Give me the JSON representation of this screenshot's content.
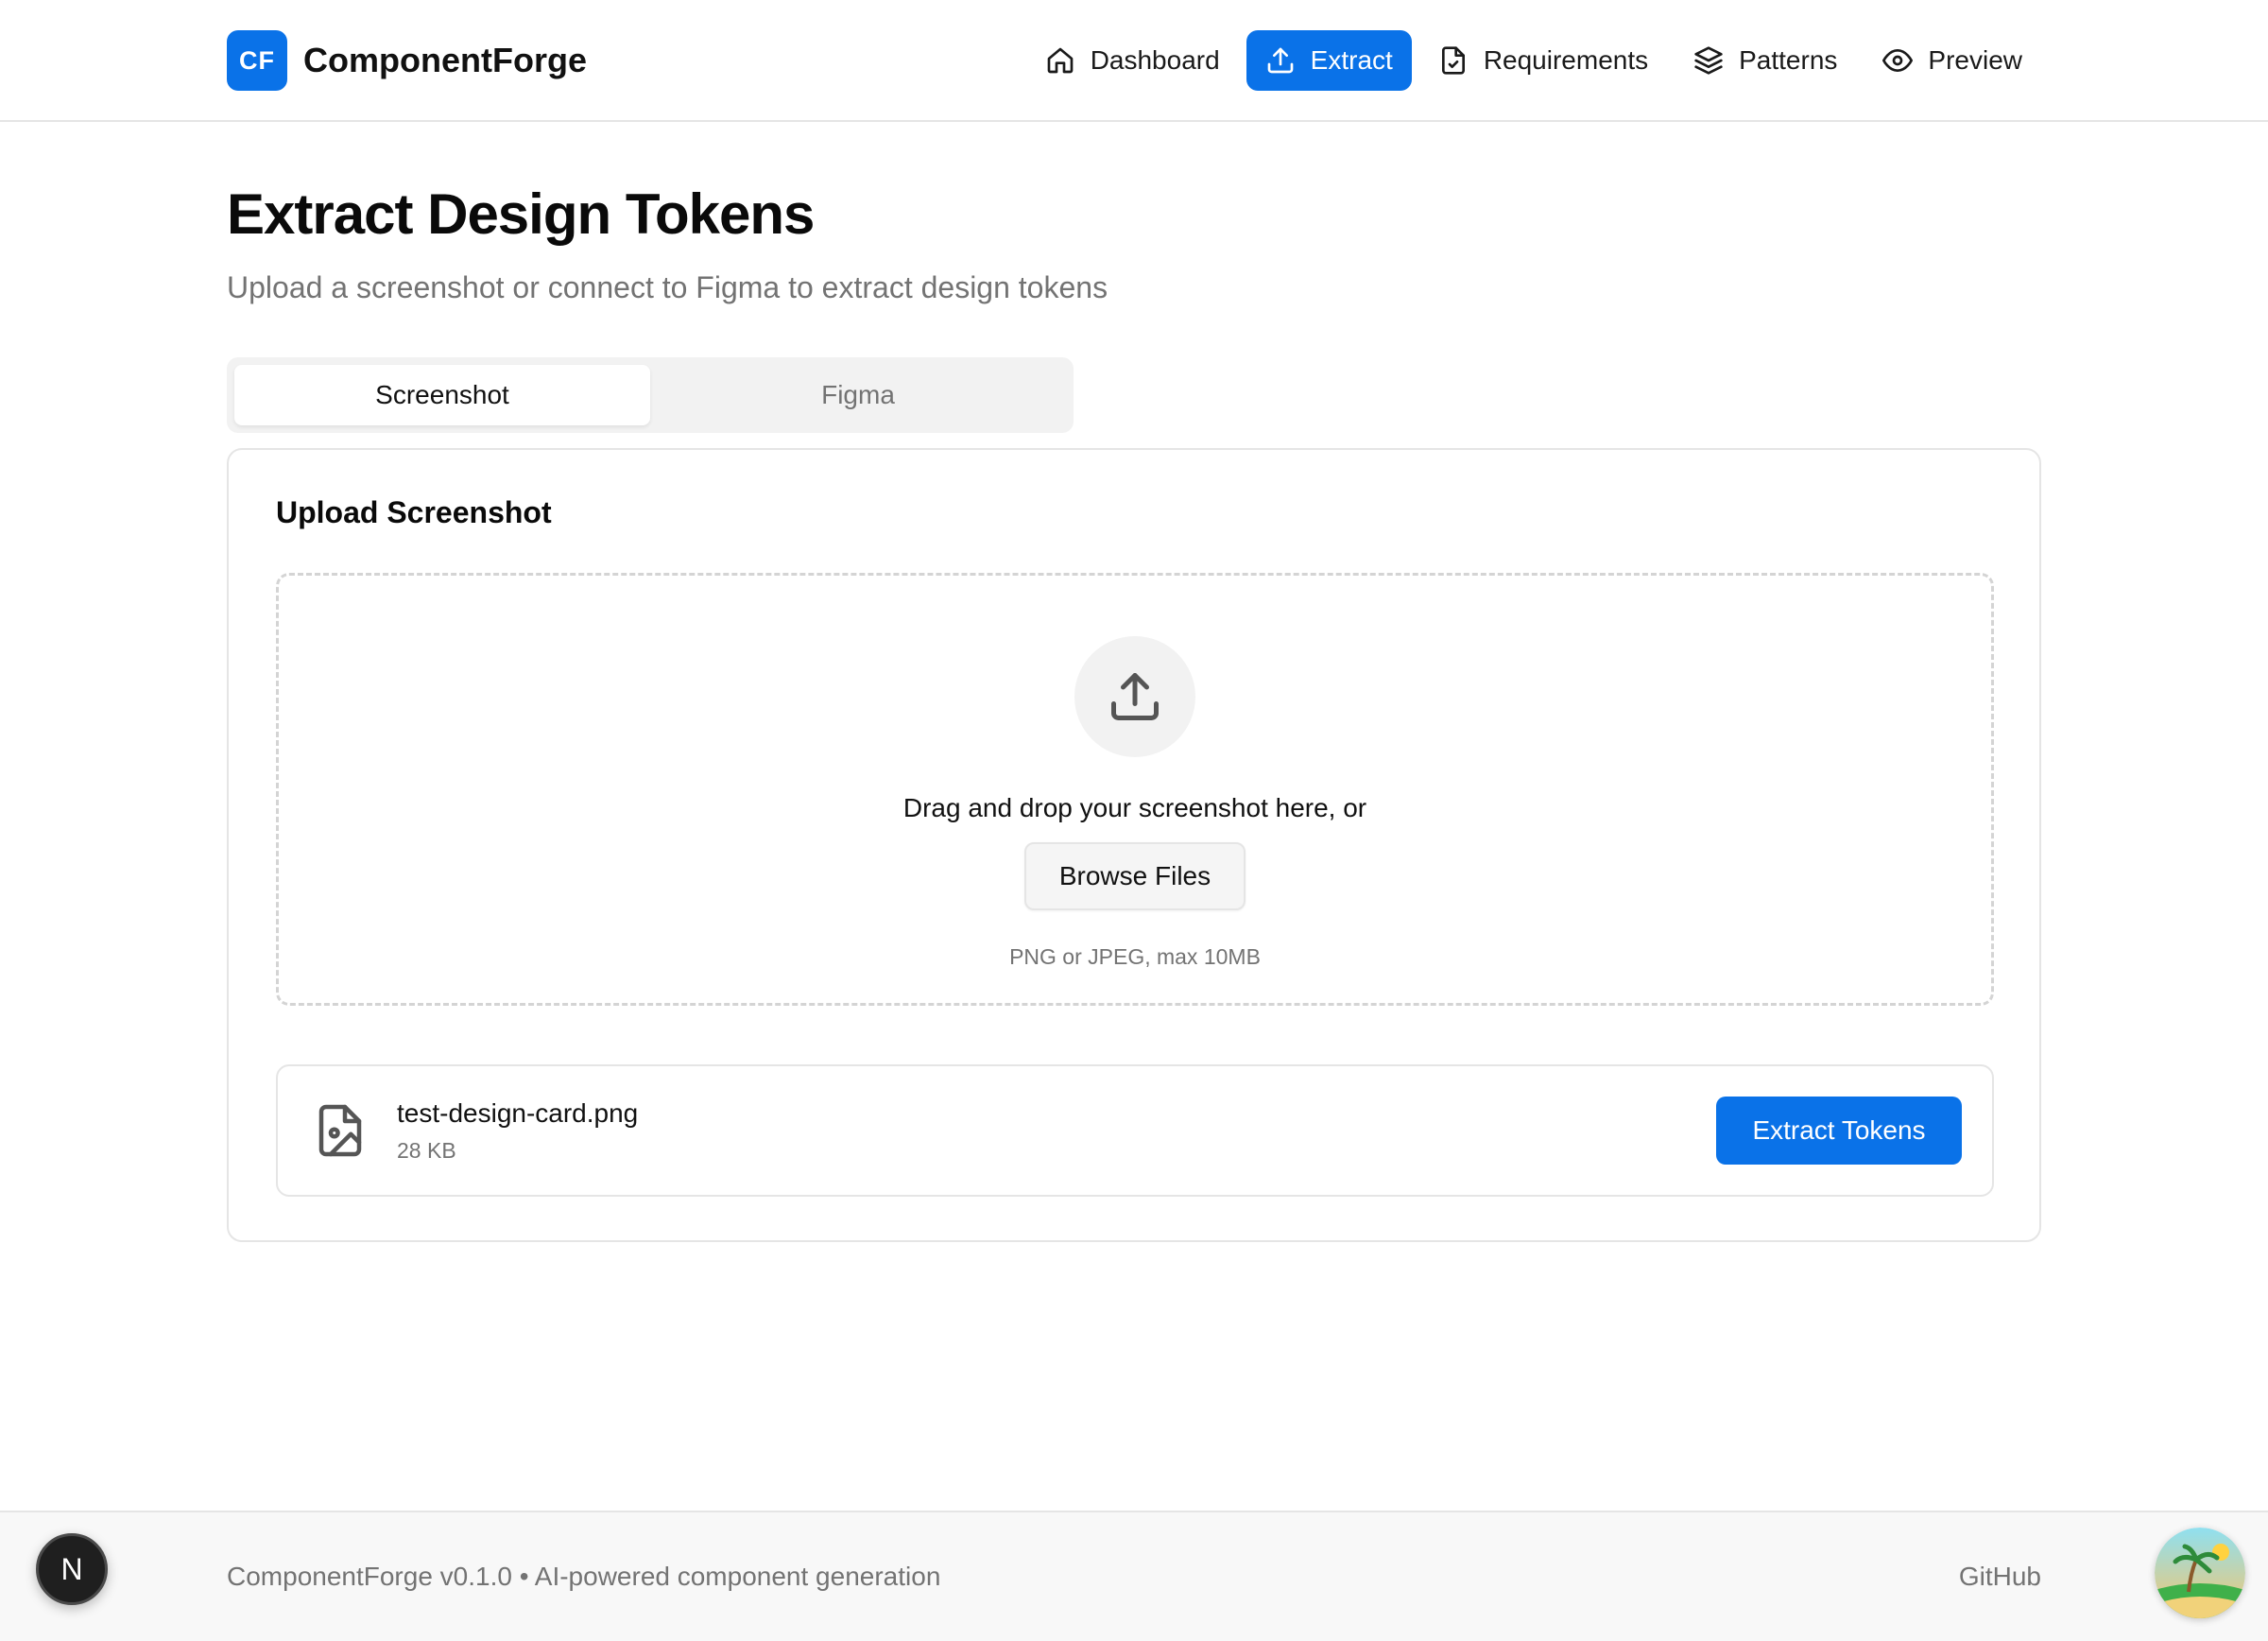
{
  "brand": {
    "badge": "CF",
    "name": "ComponentForge"
  },
  "nav": {
    "items": [
      {
        "label": "Dashboard",
        "icon": "home-icon"
      },
      {
        "label": "Extract",
        "icon": "upload-icon",
        "active": true
      },
      {
        "label": "Requirements",
        "icon": "file-check-icon"
      },
      {
        "label": "Patterns",
        "icon": "layers-icon"
      },
      {
        "label": "Preview",
        "icon": "eye-icon"
      }
    ]
  },
  "page": {
    "title": "Extract Design Tokens",
    "subtitle": "Upload a screenshot or connect to Figma to extract design tokens"
  },
  "tabs": [
    {
      "label": "Screenshot",
      "active": true
    },
    {
      "label": "Figma",
      "active": false
    }
  ],
  "upload": {
    "title": "Upload Screenshot",
    "drop_text": "Drag and drop your screenshot here, or",
    "browse_label": "Browse Files",
    "hint": "PNG or JPEG, max 10MB"
  },
  "file": {
    "name": "test-design-card.png",
    "size": "28 KB",
    "action_label": "Extract Tokens"
  },
  "footer": {
    "text": "ComponentForge v0.1.0 • AI-powered component generation",
    "link": "GitHub"
  },
  "dev_badge": "N",
  "colors": {
    "accent": "#0a72e8",
    "muted_text": "#737373",
    "border": "#e5e5e5"
  }
}
